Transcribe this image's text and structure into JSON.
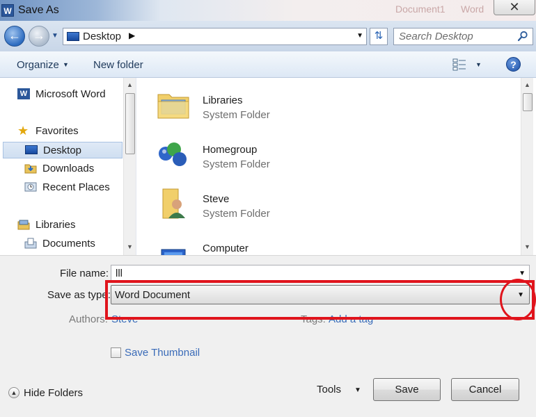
{
  "window": {
    "title": "Save As",
    "close_glyph": "✕",
    "background_document": "Document1",
    "background_app": "Word"
  },
  "address": {
    "location": "Desktop",
    "search_placeholder": "Search Desktop"
  },
  "toolbar": {
    "organize_label": "Organize",
    "new_folder_label": "New folder",
    "help_glyph": "?"
  },
  "navigation": {
    "items": [
      {
        "label": "Microsoft Word",
        "icon": "word-icon"
      },
      {
        "label": "Favorites",
        "icon": "star-icon"
      },
      {
        "label": "Desktop",
        "icon": "desktop-icon",
        "selected": true
      },
      {
        "label": "Downloads",
        "icon": "downloads-icon"
      },
      {
        "label": "Recent Places",
        "icon": "recent-places-icon"
      },
      {
        "label": "Libraries",
        "icon": "libraries-icon"
      },
      {
        "label": "Documents",
        "icon": "documents-icon"
      }
    ]
  },
  "files": [
    {
      "name": "Libraries",
      "type": "System Folder",
      "icon": "libraries-folder-icon"
    },
    {
      "name": "Homegroup",
      "type": "System Folder",
      "icon": "homegroup-icon"
    },
    {
      "name": "Steve",
      "type": "System Folder",
      "icon": "user-folder-icon"
    },
    {
      "name": "Computer",
      "type": "",
      "icon": "computer-icon"
    }
  ],
  "form": {
    "file_name_label": "File name:",
    "file_name_value": "lll",
    "save_type_label": "Save as type:",
    "save_type_value": "Word Document",
    "authors_label": "Authors:",
    "authors_value": "Steve",
    "tags_label": "Tags:",
    "tags_value": "Add a tag",
    "save_thumbnail_label": "Save Thumbnail",
    "save_thumbnail_checked": false
  },
  "footer": {
    "hide_folders_label": "Hide Folders",
    "tools_label": "Tools",
    "save_label": "Save",
    "cancel_label": "Cancel"
  },
  "annotation": {
    "color": "#e0141c"
  }
}
